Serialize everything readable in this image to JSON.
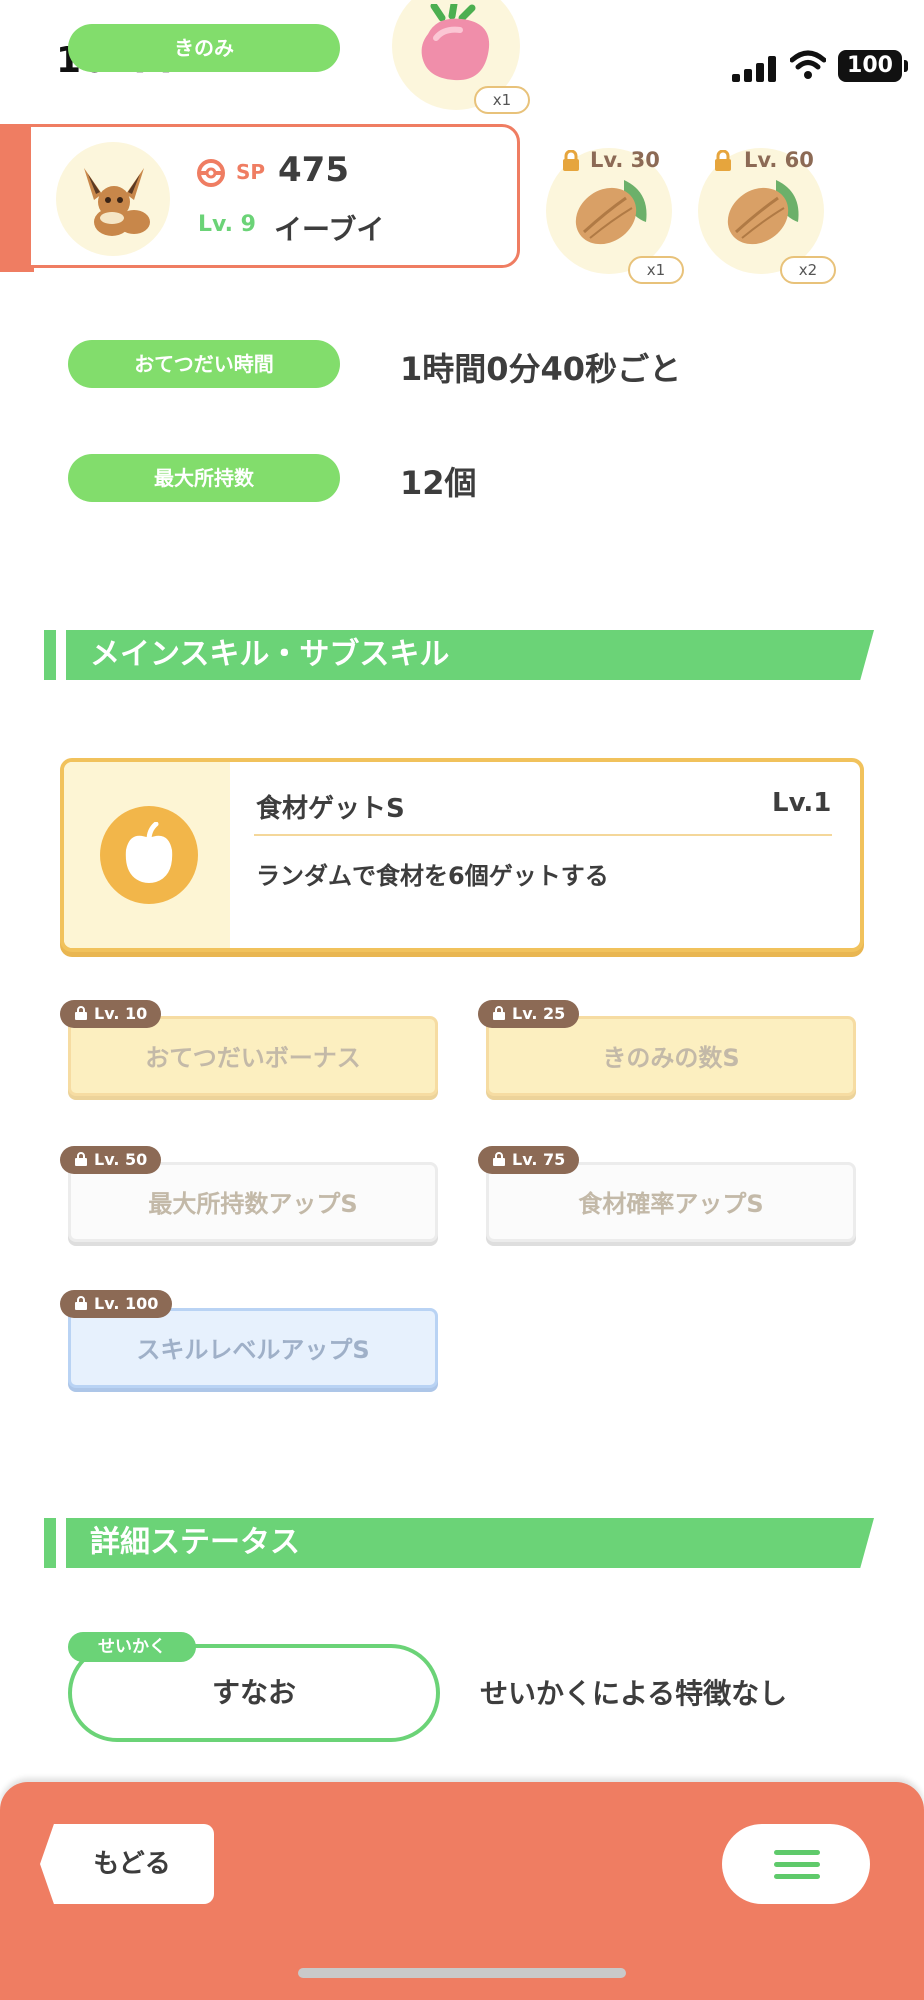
{
  "status_bar": {
    "time": "10:44",
    "battery": "100"
  },
  "berry": {
    "label": "きのみ",
    "count": "x1"
  },
  "ingredients": [
    {
      "unlock": "Lv. 30",
      "count": "x1"
    },
    {
      "unlock": "Lv. 60",
      "count": "x2"
    }
  ],
  "pokemon": {
    "sp_label": "SP",
    "sp_value": "475",
    "level": "Lv. 9",
    "name": "イーブイ"
  },
  "stats": [
    {
      "label": "おてつだい時間",
      "value": "1時間0分40秒ごと"
    },
    {
      "label": "最大所持数",
      "value": "12個"
    }
  ],
  "skills_section": {
    "title": "メインスキル・サブスキル",
    "main_skill": {
      "name": "食材ゲットS",
      "level": "Lv.1",
      "description": "ランダムで食材を6個ゲットする"
    },
    "sub_skills": [
      {
        "unlock": "Lv. 10",
        "name": "おてつだいボーナス"
      },
      {
        "unlock": "Lv. 25",
        "name": "きのみの数S"
      },
      {
        "unlock": "Lv. 50",
        "name": "最大所持数アップS"
      },
      {
        "unlock": "Lv. 75",
        "name": "食材確率アップS"
      },
      {
        "unlock": "Lv. 100",
        "name": "スキルレベルアップS"
      }
    ]
  },
  "details_section": {
    "title": "詳細ステータス",
    "nature_label": "せいかく",
    "nature_value": "すなお",
    "nature_effect": "せいかくによる特徴なし"
  },
  "footer": {
    "back_label": "もどる"
  },
  "colors": {
    "accent_green": "#6bd377",
    "footer_coral": "#ef7d62",
    "skill_gold": "#f1c25c"
  }
}
